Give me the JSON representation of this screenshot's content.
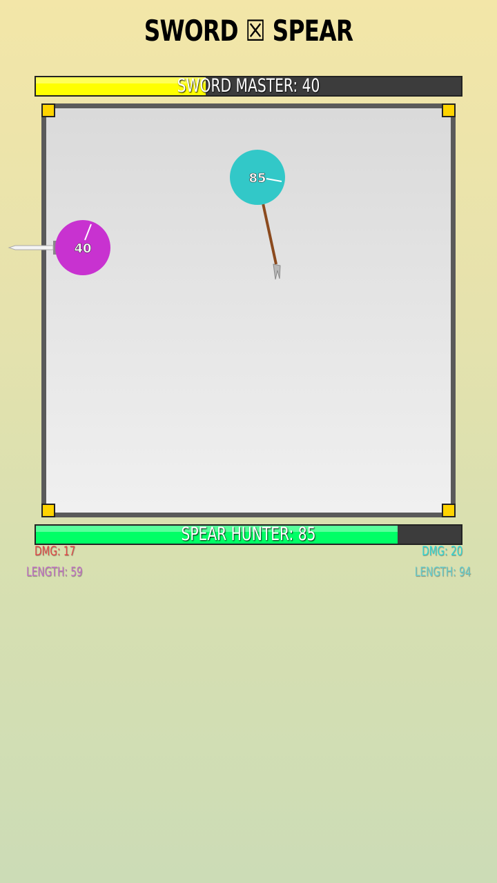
{
  "title": "SWORD ☒ SPEAR",
  "sword_bar": {
    "label": "SWORD MASTER: 40",
    "fill_fraction": 0.4,
    "color": "#ffff00"
  },
  "spear_bar": {
    "label": "SPEAR HUNTER: 85",
    "fill_fraction": 0.85,
    "color": "#00ff66"
  },
  "sword_ball": {
    "hp": "40",
    "color": "#c832d0"
  },
  "spear_ball": {
    "hp": "85",
    "color": "#32c8c8"
  },
  "stats": {
    "sword_dmg": "DMG: 17",
    "spear_dmg": "DMG: 20",
    "sword_length": "LENGTH: 59",
    "spear_length": "LENGTH: 94",
    "sword_color": "#e04545",
    "spear_color": "#2fd6d6",
    "sword_length_color": "#c06fc4",
    "spear_length_color": "#66cccc"
  },
  "colors": {
    "corner": "#ffd400",
    "arena_border": "#5a5a5a",
    "spear_shaft": "#8b4a1e"
  }
}
